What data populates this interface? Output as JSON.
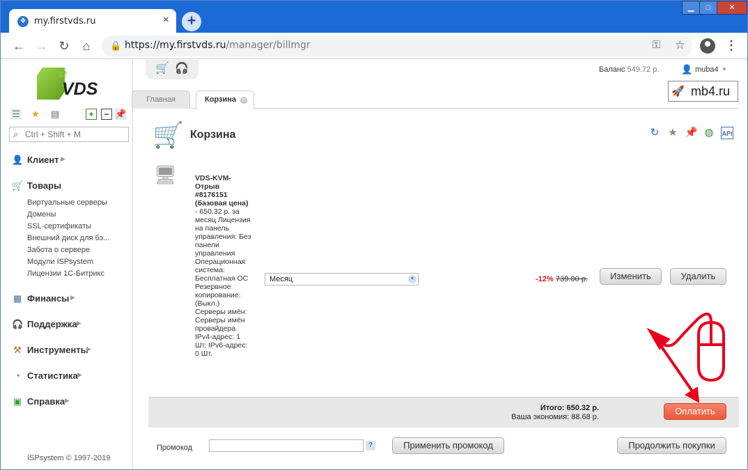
{
  "browser": {
    "tab_title": "my.firstvds.ru",
    "tab_close": "×",
    "new_tab": "+",
    "url_host": "https://my.firstvds.ru",
    "url_path": "/manager/billmgr",
    "window_controls": {
      "minimize": "▁",
      "maximize": "□",
      "close": "✕"
    }
  },
  "sidebar": {
    "logo_sup": "st",
    "logo_text": "VDS",
    "search_placeholder": "Ctrl + Shift + M",
    "sections": [
      {
        "label": "Клиент",
        "icon": "user-icon"
      },
      {
        "label": "Товары",
        "icon": "cart-icon",
        "items": [
          "Виртуальные серверы",
          "Домены",
          "SSL-сертификаты",
          "Внешний диск для бэ...",
          "Забота о сервере",
          "Модули ISPsystem",
          "Лицензии 1С-Битрикс"
        ]
      },
      {
        "label": "Финансы",
        "icon": "finance-icon"
      },
      {
        "label": "Поддержка",
        "icon": "headset-icon"
      },
      {
        "label": "Инструменты",
        "icon": "tools-icon"
      },
      {
        "label": "Статистика",
        "icon": "chart-icon"
      },
      {
        "label": "Справка",
        "icon": "help-icon"
      }
    ],
    "copyright": "ISPsystem © 1997-2019"
  },
  "header": {
    "balance_label": "Баланс",
    "balance_value": "549.72 р.",
    "username": "muba4",
    "watermark": "mb4.ru"
  },
  "tabs": [
    {
      "label": "Главная"
    },
    {
      "label": "Корзина"
    }
  ],
  "cart": {
    "title": "Корзина",
    "item": {
      "name": "VDS-KVM-Отрыв #8176151 (базовая цена)",
      "details": "- 650.32 р. за месяц Лицензия на панель управления: Без панели управления Операционная система: Бесплатная ОС Резервное копирование: (Выкл.) Серверы имён: Серверы имён провайдера IPv4-адрес: 1 Шт. IPv6-адрес: 0 Шт.",
      "period": "Месяц",
      "discount": "-12%",
      "old_price": "739.00 р.",
      "change_label": "Изменить",
      "delete_label": "Удалить"
    },
    "total": "Итого: 650.32 р.",
    "savings": "Ваша экономия: 88.68 р.",
    "pay_label": "Оплатить",
    "promo_label": "Промокод",
    "promo_help": "?",
    "apply_promo_label": "Применить промокод",
    "continue_label": "Продолжить покупки"
  },
  "colors": {
    "chrome": "#1c6ad6",
    "pay": "#ea5a3d",
    "annotation": "#e8001c"
  }
}
